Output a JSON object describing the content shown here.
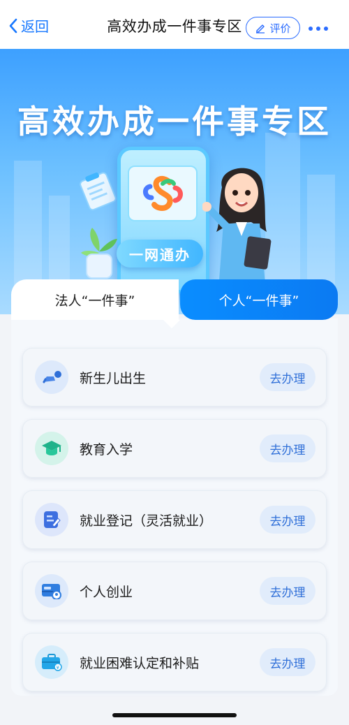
{
  "header": {
    "back_label": "返回",
    "title": "高效办成一件事专区",
    "rate_label": "评价"
  },
  "banner": {
    "title": "高效办成一件事专区",
    "phone_badge": "一网通办",
    "colors": {
      "top": "#3da0ff",
      "bottom": "#a9dbff"
    }
  },
  "tabs": {
    "left_label": "法人“一件事”",
    "right_label": "个人“一件事”",
    "active": "right"
  },
  "services": [
    {
      "label": "新生儿出生",
      "action": "去办理",
      "icon": "baby-crawl-icon"
    },
    {
      "label": "教育入学",
      "action": "去办理",
      "icon": "graduation-cap-icon"
    },
    {
      "label": "就业登记（灵活就业）",
      "action": "去办理",
      "icon": "registration-form-icon"
    },
    {
      "label": "个人创业",
      "action": "去办理",
      "icon": "entrepreneur-card-icon"
    },
    {
      "label": "就业困难认定和补贴",
      "action": "去办理",
      "icon": "briefcase-subsidy-icon"
    }
  ]
}
